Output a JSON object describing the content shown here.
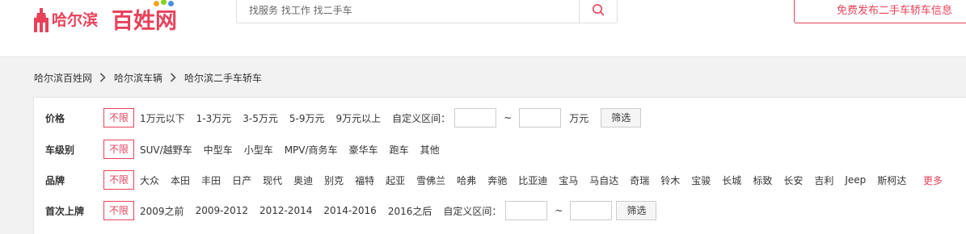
{
  "header": {
    "logo_city": "哈尔滨",
    "logo_brand": "百姓网",
    "search_placeholder": "找服务 找工作 找二手车",
    "publish_label": "免费发布二手车轿车信息"
  },
  "breadcrumb": [
    {
      "label": "哈尔滨百姓网"
    },
    {
      "label": "哈尔滨车辆"
    },
    {
      "label": "哈尔滨二手车轿车"
    }
  ],
  "filters": {
    "price": {
      "label": "价格",
      "active": "不限",
      "options": [
        "1万元以下",
        "1-3万元",
        "3-5万元",
        "5-9万元",
        "9万元以上"
      ],
      "range_label": "自定义区间：",
      "tilde": "~",
      "unit": "万元",
      "button": "筛选"
    },
    "class": {
      "label": "车级别",
      "active": "不限",
      "options": [
        "SUV/越野车",
        "中型车",
        "小型车",
        "MPV/商务车",
        "豪华车",
        "跑车",
        "其他"
      ]
    },
    "brand": {
      "label": "品牌",
      "active": "不限",
      "options": [
        "大众",
        "本田",
        "丰田",
        "日产",
        "现代",
        "奥迪",
        "别克",
        "福特",
        "起亚",
        "雪佛兰",
        "哈弗",
        "奔驰",
        "比亚迪",
        "宝马",
        "马自达",
        "奇瑞",
        "铃木",
        "宝骏",
        "长城",
        "标致",
        "长安",
        "吉利",
        "Jeep",
        "斯柯达"
      ],
      "more": "更多"
    },
    "year": {
      "label": "首次上牌",
      "active": "不限",
      "options": [
        "2009之前",
        "2009-2012",
        "2012-2014",
        "2014-2016",
        "2016之后"
      ],
      "range_label": "自定义区间：",
      "tilde": "~",
      "button": "筛选"
    }
  },
  "colors": {
    "accent": "#e8425a",
    "logo_dots": [
      "#f5a623",
      "#7ed321",
      "#4a90e2",
      "#e8425a",
      "#9b59b6"
    ]
  }
}
